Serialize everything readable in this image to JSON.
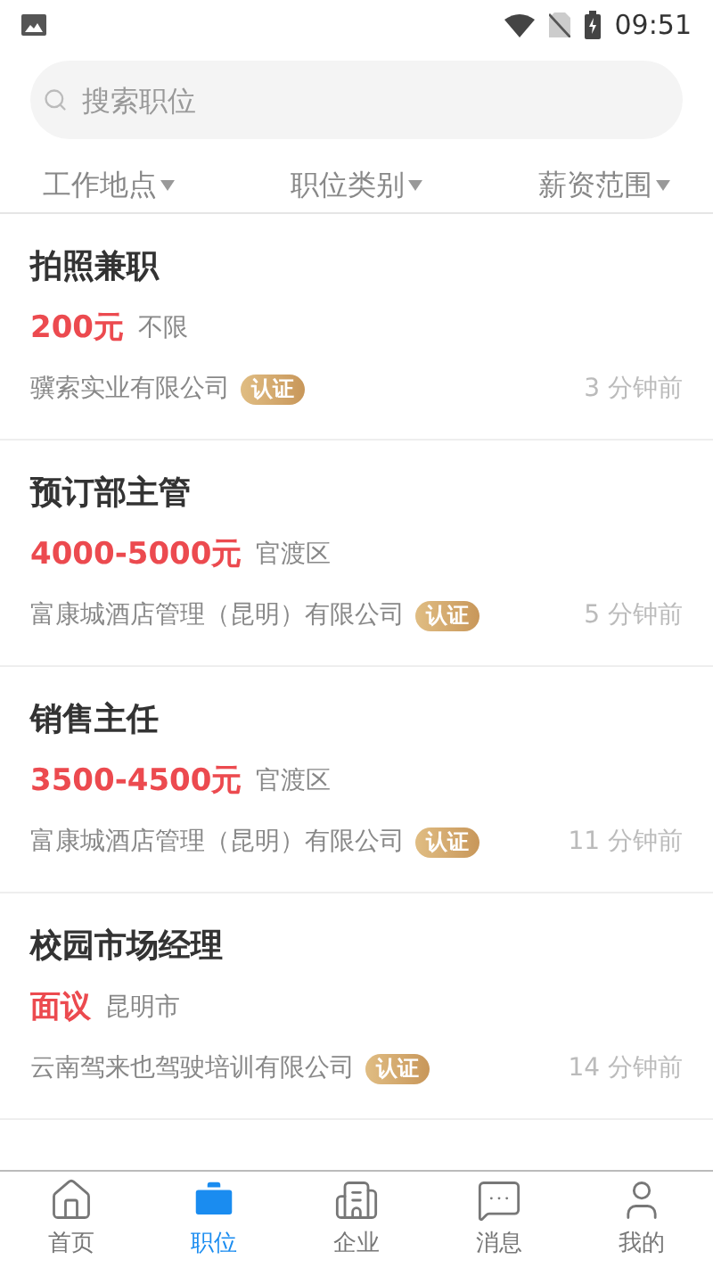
{
  "status_bar": {
    "time": "09:51"
  },
  "search": {
    "placeholder": "搜索职位"
  },
  "filters": [
    {
      "label": "工作地点"
    },
    {
      "label": "职位类别"
    },
    {
      "label": "薪资范围"
    }
  ],
  "jobs": [
    {
      "title": "拍照兼职",
      "salary": "200元",
      "location": "不限",
      "company": "骥索实业有限公司",
      "badge": "认证",
      "time": "3 分钟前"
    },
    {
      "title": "预订部主管",
      "salary": "4000-5000元",
      "location": "官渡区",
      "company": "富康城酒店管理（昆明）有限公司",
      "badge": "认证",
      "time": "5 分钟前"
    },
    {
      "title": "销售主任",
      "salary": "3500-4500元",
      "location": "官渡区",
      "company": "富康城酒店管理（昆明）有限公司",
      "badge": "认证",
      "time": "11 分钟前"
    },
    {
      "title": "校园市场经理",
      "salary": "面议",
      "location": "昆明市",
      "company": "云南驾来也驾驶培训有限公司",
      "badge": "认证",
      "time": "14 分钟前"
    }
  ],
  "bottom_nav": [
    {
      "label": "首页",
      "kind": "home",
      "selected": false
    },
    {
      "label": "职位",
      "kind": "jobs",
      "selected": true
    },
    {
      "label": "企业",
      "kind": "company",
      "selected": false
    },
    {
      "label": "消息",
      "kind": "messages",
      "selected": false
    },
    {
      "label": "我的",
      "kind": "profile",
      "selected": false
    }
  ]
}
